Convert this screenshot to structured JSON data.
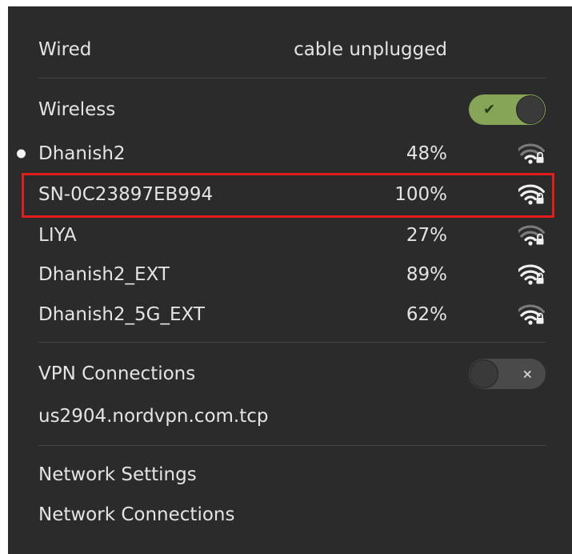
{
  "wired": {
    "label": "Wired",
    "status": "cable unplugged"
  },
  "wireless": {
    "label": "Wireless",
    "enabled": true,
    "toggle_mark": "✔",
    "networks": [
      {
        "ssid": "Dhanish2",
        "signal": "48%",
        "connected": true,
        "signal_icon": "wifi-lock-icon"
      },
      {
        "ssid": "SN-0C23897EB994",
        "signal": "100%",
        "connected": false,
        "signal_icon": "wifi-lock-icon"
      },
      {
        "ssid": "LIYA",
        "signal": "27%",
        "connected": false,
        "signal_icon": "wifi-lock-icon"
      },
      {
        "ssid": "Dhanish2_EXT",
        "signal": "89%",
        "connected": false,
        "signal_icon": "wifi-lock-icon"
      },
      {
        "ssid": "Dhanish2_5G_EXT",
        "signal": "62%",
        "connected": false,
        "signal_icon": "wifi-lock-icon"
      }
    ]
  },
  "vpn": {
    "label": "VPN Connections",
    "enabled": false,
    "toggle_mark": "×",
    "connections": [
      "us2904.nordvpn.com.tcp"
    ]
  },
  "footer": {
    "settings_label": "Network Settings",
    "connections_label": "Network Connections"
  },
  "colors": {
    "panel_bg": "#2b2b2b",
    "text": "#e4e4e4",
    "toggle_on": "#87a556",
    "toggle_off": "#4a4a4a",
    "highlight": "#e01c1c"
  }
}
